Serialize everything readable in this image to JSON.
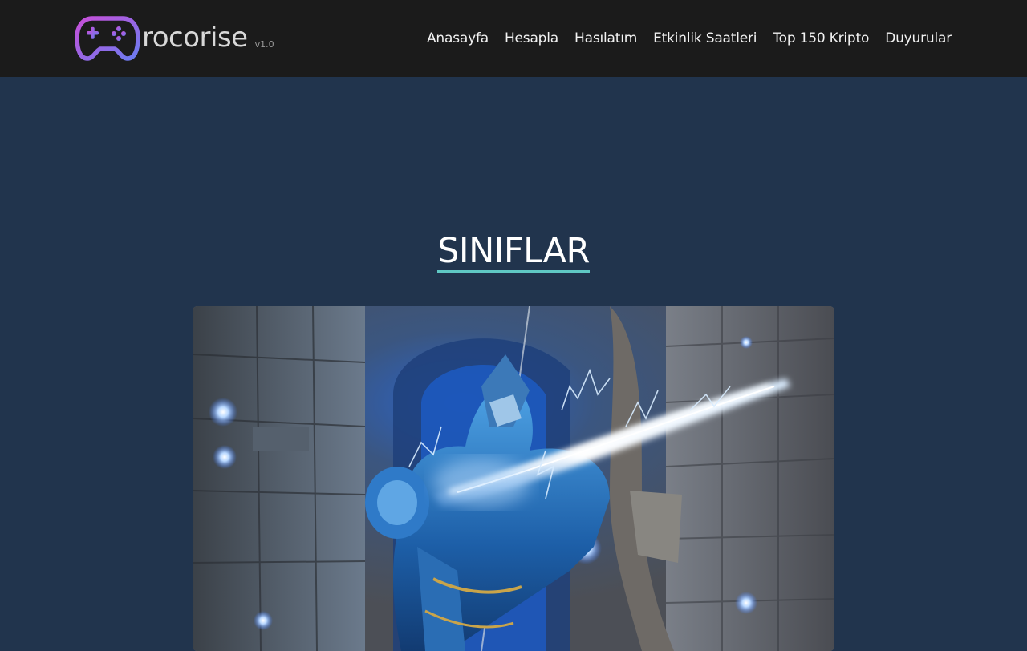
{
  "header": {
    "brand_name": "rocorise",
    "brand_version": "v1.0",
    "logo_icon": "gamepad-icon",
    "nav_items": [
      {
        "label": "Anasayfa"
      },
      {
        "label": "Hesapla"
      },
      {
        "label": "Hasılatım"
      },
      {
        "label": "Etkinlik Saatleri"
      },
      {
        "label": "Top 150 Kripto"
      },
      {
        "label": "Duyurular"
      }
    ]
  },
  "main": {
    "section_title": "SINIFLAR",
    "hero_image_subject": "armored archer with lightning bow"
  },
  "colors": {
    "navbar_bg": "#1b1b1b",
    "page_bg": "#21344d",
    "title_underline": "#5fc8c4",
    "logo_gradient_start": "#c84fd8",
    "logo_gradient_end": "#6a7cf0"
  }
}
